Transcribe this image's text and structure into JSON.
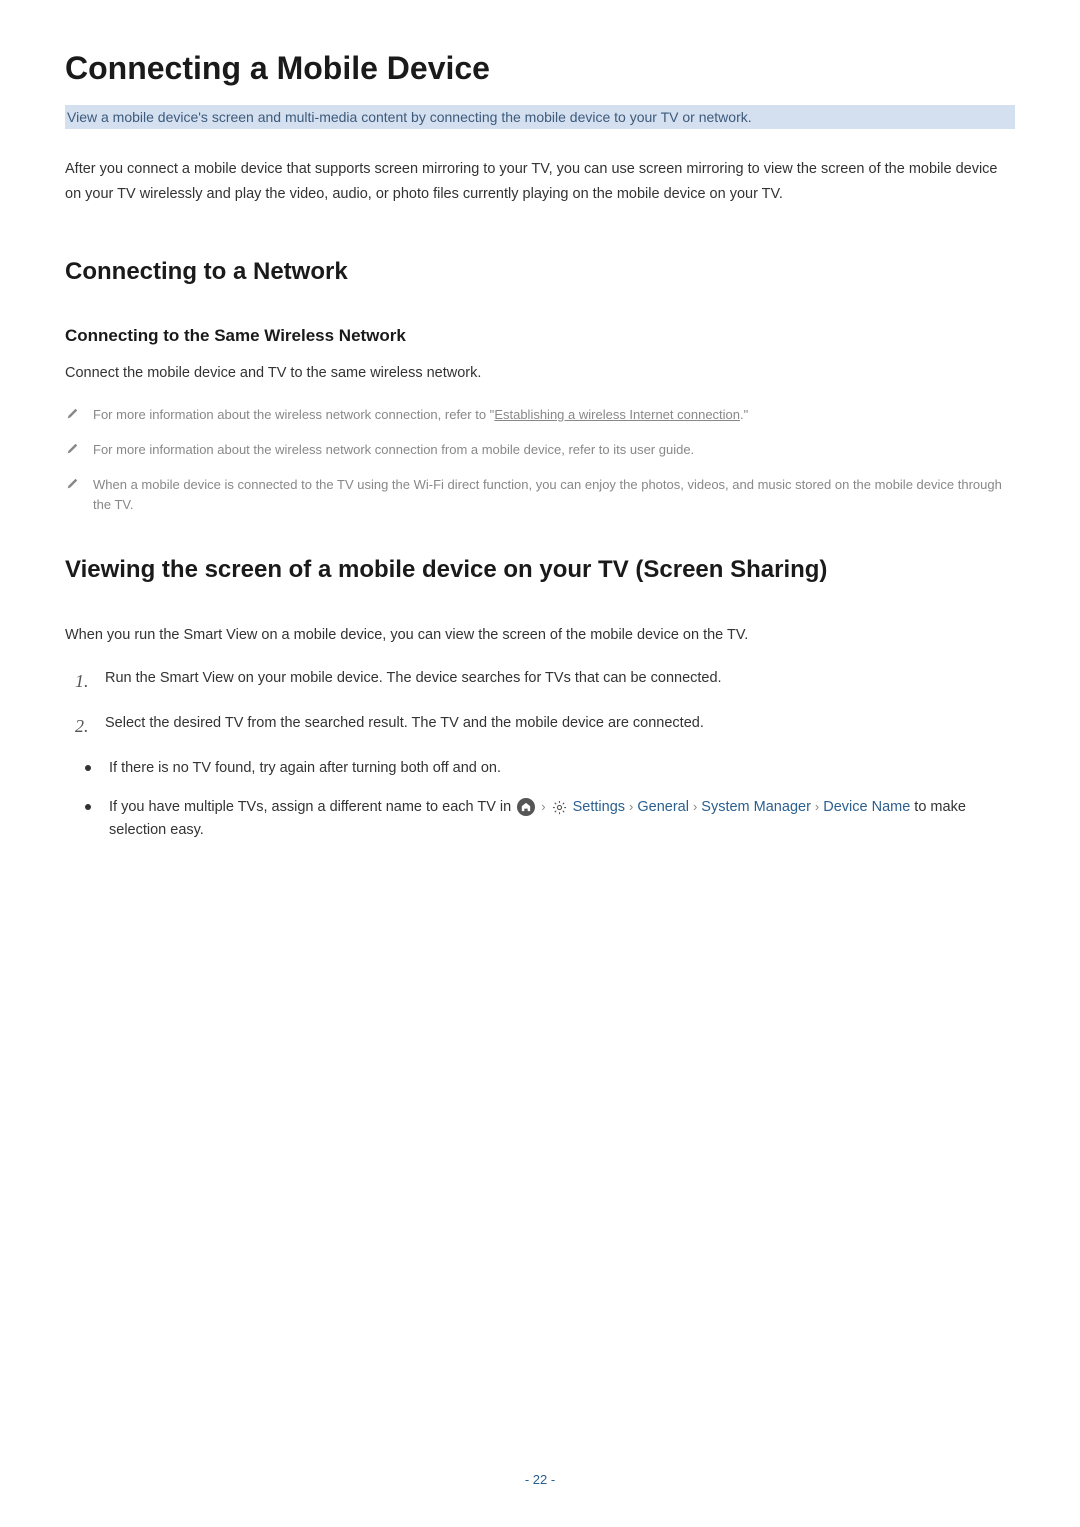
{
  "main_title": "Connecting a Mobile Device",
  "subtitle": "View a mobile device's screen and multi-media content by connecting the mobile device to your TV or network.",
  "intro": "After you connect a mobile device that supports screen mirroring to your TV, you can use screen mirroring to view the screen of the mobile device on your TV wirelessly and play the video, audio, or photo files currently playing on the mobile device on your TV.",
  "section1": {
    "title": "Connecting to a Network",
    "subsection_title": "Connecting to the Same Wireless Network",
    "body": "Connect the mobile device and TV to the same wireless network.",
    "notes": {
      "n1_pre": "For more information about the wireless network connection, refer to \"",
      "n1_link": "Establishing a wireless Internet connection",
      "n1_post": ".\"",
      "n2": "For more information about the wireless network connection from a mobile device, refer to its user guide.",
      "n3": "When a mobile device is connected to the TV using the Wi-Fi direct function, you can enjoy the photos, videos, and music stored on the mobile device through the TV."
    }
  },
  "section2": {
    "title": "Viewing the screen of a mobile device on your TV (Screen Sharing)",
    "intro": "When you run the Smart View on a mobile device, you can view the screen of the mobile device on the TV.",
    "steps": {
      "s1": "Run the Smart View on your mobile device. The device searches for TVs that can be connected.",
      "s2": "Select the desired TV from the searched result. The TV and the mobile device are connected."
    },
    "bullets": {
      "b1": "If there is no TV found, try again after turning both off and on.",
      "b2_pre": "If you have multiple TVs, assign a different name to each TV in ",
      "b2_nav": {
        "settings": "Settings",
        "general": "General",
        "system_manager": "System Manager",
        "device_name": "Device Name"
      },
      "b2_post": " to make selection easy."
    }
  },
  "page_number": "- 22 -"
}
